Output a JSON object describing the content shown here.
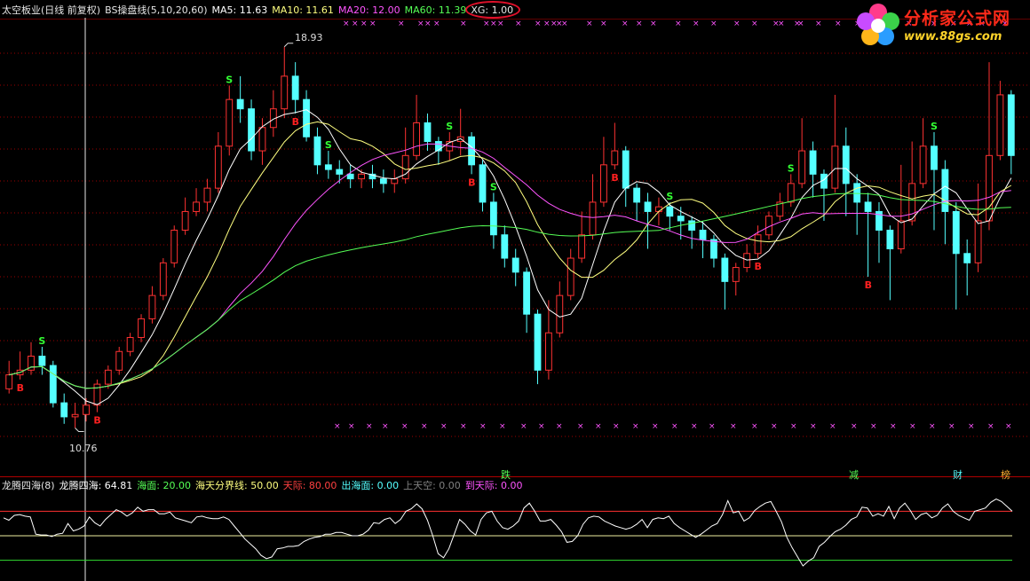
{
  "main_header": {
    "title": "太空板业(日线 前复权)",
    "indicator": "BS操盘线(5,10,20,60)",
    "ma5": "MA5: 11.63",
    "ma10": "MA10: 11.61",
    "ma20": "MA20: 12.00",
    "ma60": "MA60: 11.39",
    "xg": "XG: 1.00"
  },
  "colors": {
    "background": "#000000",
    "up_candle": "#ff3232",
    "down_candle": "#54ffff",
    "ma5": "#ffffff",
    "ma10": "#ffff80",
    "ma20": "#ff55ff",
    "ma60": "#55ff55",
    "grid": "#9a0000",
    "highlight_ring": "#e0102a"
  },
  "price_labels": {
    "high": "18.93",
    "low": "10.76"
  },
  "signals": {
    "buy": "B",
    "sell": "S"
  },
  "event_tags": [
    "跌",
    "减",
    "财",
    "榜"
  ],
  "watermark": {
    "title": "分析家公式网",
    "url": "www.88gs.com",
    "icon": "flower-logo-icon"
  },
  "marks": {
    "cross": "×"
  },
  "sub_header": {
    "title": "龙腾四海(8)",
    "value": "龙腾四海: 64.81",
    "haimian": "海面: 20.00",
    "fenjie": "海天分界线: 50.00",
    "tianji": "天际: 80.00",
    "chu": "出海面: 0.00",
    "shang": "上天空: 0.00",
    "dao": "到天际: 0.00"
  },
  "chart_data": [
    {
      "type": "candlestick",
      "title": "太空板业(日线 前复权)",
      "ylim": [
        10.2,
        19.4
      ],
      "high_label": 18.93,
      "low_label": 10.76,
      "candles": [
        {
          "o": 11.6,
          "c": 11.9,
          "h": 12.2,
          "l": 11.5
        },
        {
          "o": 11.9,
          "c": 12.0,
          "h": 12.4,
          "l": 11.8
        },
        {
          "o": 12.0,
          "c": 12.3,
          "h": 12.6,
          "l": 11.9
        },
        {
          "o": 12.3,
          "c": 12.1,
          "h": 12.5,
          "l": 11.9
        },
        {
          "o": 12.1,
          "c": 11.3,
          "h": 12.2,
          "l": 11.2
        },
        {
          "o": 11.3,
          "c": 11.0,
          "h": 11.5,
          "l": 10.85
        },
        {
          "o": 11.0,
          "c": 11.05,
          "h": 11.3,
          "l": 10.76
        },
        {
          "o": 11.05,
          "c": 11.25,
          "h": 11.4,
          "l": 10.9
        },
        {
          "o": 11.25,
          "c": 11.7,
          "h": 11.8,
          "l": 11.1
        },
        {
          "o": 11.7,
          "c": 12.0,
          "h": 12.1,
          "l": 11.6
        },
        {
          "o": 12.0,
          "c": 12.4,
          "h": 12.5,
          "l": 11.9
        },
        {
          "o": 12.4,
          "c": 12.7,
          "h": 12.8,
          "l": 12.3
        },
        {
          "o": 12.7,
          "c": 13.1,
          "h": 13.2,
          "l": 12.6
        },
        {
          "o": 13.1,
          "c": 13.6,
          "h": 13.8,
          "l": 13.0
        },
        {
          "o": 13.6,
          "c": 14.3,
          "h": 14.4,
          "l": 13.5
        },
        {
          "o": 14.3,
          "c": 15.0,
          "h": 15.1,
          "l": 14.2
        },
        {
          "o": 15.0,
          "c": 15.4,
          "h": 15.7,
          "l": 14.9
        },
        {
          "o": 15.4,
          "c": 15.6,
          "h": 15.9,
          "l": 15.3
        },
        {
          "o": 15.6,
          "c": 15.9,
          "h": 16.1,
          "l": 15.4
        },
        {
          "o": 15.9,
          "c": 16.8,
          "h": 17.1,
          "l": 15.8
        },
        {
          "o": 16.8,
          "c": 17.8,
          "h": 18.1,
          "l": 16.6
        },
        {
          "o": 17.8,
          "c": 17.6,
          "h": 18.3,
          "l": 17.3
        },
        {
          "o": 17.6,
          "c": 16.7,
          "h": 17.8,
          "l": 16.5
        },
        {
          "o": 16.7,
          "c": 17.2,
          "h": 17.4,
          "l": 16.4
        },
        {
          "o": 17.2,
          "c": 17.6,
          "h": 18.0,
          "l": 17.0
        },
        {
          "o": 17.6,
          "c": 18.3,
          "h": 18.93,
          "l": 17.4
        },
        {
          "o": 18.3,
          "c": 17.8,
          "h": 18.6,
          "l": 17.5
        },
        {
          "o": 17.8,
          "c": 17.0,
          "h": 18.0,
          "l": 16.9
        },
        {
          "o": 17.0,
          "c": 16.4,
          "h": 17.2,
          "l": 16.2
        },
        {
          "o": 16.4,
          "c": 16.3,
          "h": 16.7,
          "l": 16.1
        },
        {
          "o": 16.3,
          "c": 16.2,
          "h": 16.5,
          "l": 16.0
        },
        {
          "o": 16.2,
          "c": 16.1,
          "h": 16.4,
          "l": 15.9
        },
        {
          "o": 16.1,
          "c": 16.2,
          "h": 16.3,
          "l": 15.9
        },
        {
          "o": 16.2,
          "c": 16.1,
          "h": 16.4,
          "l": 15.9
        },
        {
          "o": 16.1,
          "c": 16.0,
          "h": 16.3,
          "l": 15.8
        },
        {
          "o": 16.0,
          "c": 16.1,
          "h": 16.3,
          "l": 15.8
        },
        {
          "o": 16.1,
          "c": 16.6,
          "h": 17.2,
          "l": 16.0
        },
        {
          "o": 16.6,
          "c": 17.3,
          "h": 17.9,
          "l": 16.5
        },
        {
          "o": 17.3,
          "c": 16.9,
          "h": 17.5,
          "l": 16.7
        },
        {
          "o": 16.9,
          "c": 16.7,
          "h": 17.0,
          "l": 16.4
        },
        {
          "o": 16.7,
          "c": 16.9,
          "h": 17.1,
          "l": 16.5
        },
        {
          "o": 16.9,
          "c": 17.0,
          "h": 17.6,
          "l": 16.6
        },
        {
          "o": 17.0,
          "c": 16.4,
          "h": 17.1,
          "l": 16.2
        },
        {
          "o": 16.4,
          "c": 15.6,
          "h": 16.5,
          "l": 15.4
        },
        {
          "o": 15.6,
          "c": 14.9,
          "h": 15.8,
          "l": 14.6
        },
        {
          "o": 14.9,
          "c": 14.4,
          "h": 15.1,
          "l": 14.2
        },
        {
          "o": 14.4,
          "c": 14.1,
          "h": 14.6,
          "l": 13.8
        },
        {
          "o": 14.1,
          "c": 13.2,
          "h": 14.2,
          "l": 12.8
        },
        {
          "o": 13.2,
          "c": 12.0,
          "h": 13.3,
          "l": 11.7
        },
        {
          "o": 12.0,
          "c": 12.8,
          "h": 13.5,
          "l": 11.8
        },
        {
          "o": 12.8,
          "c": 13.6,
          "h": 13.9,
          "l": 12.7
        },
        {
          "o": 13.6,
          "c": 14.4,
          "h": 14.6,
          "l": 13.5
        },
        {
          "o": 14.4,
          "c": 14.9,
          "h": 15.4,
          "l": 14.3
        },
        {
          "o": 14.9,
          "c": 15.6,
          "h": 16.2,
          "l": 14.8
        },
        {
          "o": 15.6,
          "c": 16.4,
          "h": 17.0,
          "l": 15.5
        },
        {
          "o": 16.4,
          "c": 16.7,
          "h": 17.3,
          "l": 16.3
        },
        {
          "o": 16.7,
          "c": 15.9,
          "h": 16.8,
          "l": 15.5
        },
        {
          "o": 15.9,
          "c": 15.6,
          "h": 16.0,
          "l": 15.2
        },
        {
          "o": 15.6,
          "c": 15.4,
          "h": 15.8,
          "l": 14.6
        },
        {
          "o": 15.4,
          "c": 15.5,
          "h": 15.7,
          "l": 15.1
        },
        {
          "o": 15.5,
          "c": 15.3,
          "h": 15.6,
          "l": 15.0
        },
        {
          "o": 15.3,
          "c": 15.2,
          "h": 15.5,
          "l": 14.8
        },
        {
          "o": 15.2,
          "c": 15.0,
          "h": 15.3,
          "l": 14.6
        },
        {
          "o": 15.0,
          "c": 14.8,
          "h": 15.2,
          "l": 14.4
        },
        {
          "o": 14.8,
          "c": 14.4,
          "h": 14.9,
          "l": 14.2
        },
        {
          "o": 14.4,
          "c": 13.9,
          "h": 14.5,
          "l": 13.3
        },
        {
          "o": 13.9,
          "c": 14.2,
          "h": 14.3,
          "l": 13.6
        },
        {
          "o": 14.2,
          "c": 14.5,
          "h": 14.7,
          "l": 14.1
        },
        {
          "o": 14.5,
          "c": 14.9,
          "h": 15.1,
          "l": 14.4
        },
        {
          "o": 14.9,
          "c": 15.3,
          "h": 15.4,
          "l": 14.8
        },
        {
          "o": 15.3,
          "c": 15.6,
          "h": 15.8,
          "l": 15.2
        },
        {
          "o": 15.6,
          "c": 16.0,
          "h": 16.2,
          "l": 15.5
        },
        {
          "o": 16.0,
          "c": 16.7,
          "h": 17.4,
          "l": 15.9
        },
        {
          "o": 16.7,
          "c": 16.2,
          "h": 16.9,
          "l": 15.7
        },
        {
          "o": 16.2,
          "c": 15.9,
          "h": 16.3,
          "l": 15.2
        },
        {
          "o": 15.9,
          "c": 16.8,
          "h": 17.9,
          "l": 15.8
        },
        {
          "o": 16.8,
          "c": 16.0,
          "h": 17.2,
          "l": 15.3
        },
        {
          "o": 16.0,
          "c": 15.6,
          "h": 16.2,
          "l": 14.9
        },
        {
          "o": 15.6,
          "c": 15.4,
          "h": 15.8,
          "l": 14.0
        },
        {
          "o": 15.4,
          "c": 15.0,
          "h": 15.6,
          "l": 14.3
        },
        {
          "o": 15.0,
          "c": 14.6,
          "h": 15.1,
          "l": 13.5
        },
        {
          "o": 14.6,
          "c": 15.2,
          "h": 16.4,
          "l": 14.5
        },
        {
          "o": 15.2,
          "c": 16.0,
          "h": 16.9,
          "l": 15.1
        },
        {
          "o": 16.0,
          "c": 16.8,
          "h": 17.4,
          "l": 15.9
        },
        {
          "o": 16.8,
          "c": 16.3,
          "h": 17.1,
          "l": 15.0
        },
        {
          "o": 16.3,
          "c": 15.4,
          "h": 16.5,
          "l": 14.7
        },
        {
          "o": 15.4,
          "c": 14.5,
          "h": 15.6,
          "l": 13.3
        },
        {
          "o": 14.5,
          "c": 14.3,
          "h": 14.8,
          "l": 13.6
        },
        {
          "o": 14.3,
          "c": 15.2,
          "h": 16.0,
          "l": 14.1
        },
        {
          "o": 15.2,
          "c": 16.6,
          "h": 18.6,
          "l": 15.0
        },
        {
          "o": 16.6,
          "c": 17.9,
          "h": 18.2,
          "l": 16.5
        },
        {
          "o": 17.9,
          "c": 16.6,
          "h": 18.0,
          "l": 16.2
        }
      ]
    },
    {
      "type": "line",
      "title": "龙腾四海(8)",
      "ylim": [
        0,
        100
      ],
      "reference_lines": {
        "海面": 20,
        "海天分界线": 50,
        "天际": 80
      },
      "values": [
        72,
        69,
        75,
        76,
        74,
        73,
        52,
        51,
        51,
        49,
        52,
        53,
        65,
        56,
        58,
        62,
        73,
        66,
        62,
        70,
        76,
        82,
        79,
        74,
        78,
        85,
        80,
        82,
        82,
        77,
        77,
        79,
        72,
        70,
        68,
        66,
        73,
        74,
        72,
        71,
        71,
        73,
        70,
        62,
        54,
        46,
        40,
        34,
        26,
        22,
        24,
        34,
        35,
        37,
        37,
        38,
        43,
        46,
        48,
        49,
        52,
        52,
        54,
        54,
        52,
        50,
        50,
        52,
        57,
        66,
        65,
        70,
        72,
        65,
        70,
        80,
        83,
        89,
        83,
        69,
        50,
        28,
        23,
        34,
        52,
        70,
        64,
        56,
        51,
        70,
        78,
        80,
        68,
        60,
        58,
        62,
        68,
        84,
        90,
        80,
        68,
        68,
        70,
        63,
        55,
        42,
        43,
        50,
        64,
        72,
        74,
        73,
        68,
        65,
        62,
        60,
        58,
        60,
        64,
        70,
        60,
        70,
        72,
        71,
        74,
        65,
        60,
        56,
        52,
        48,
        52,
        57,
        62,
        65,
        76,
        93,
        78,
        80,
        68,
        72,
        81,
        86,
        90,
        92,
        80,
        67,
        48,
        35,
        24,
        13,
        19,
        23,
        37,
        42,
        49,
        55,
        58,
        63,
        70,
        73,
        85,
        84,
        74,
        77,
        74,
        86,
        71,
        84,
        90,
        81,
        70,
        76,
        78,
        72,
        75,
        84,
        89,
        80,
        75,
        72,
        69,
        80,
        82,
        84,
        91,
        95,
        92,
        86,
        80
      ]
    }
  ]
}
